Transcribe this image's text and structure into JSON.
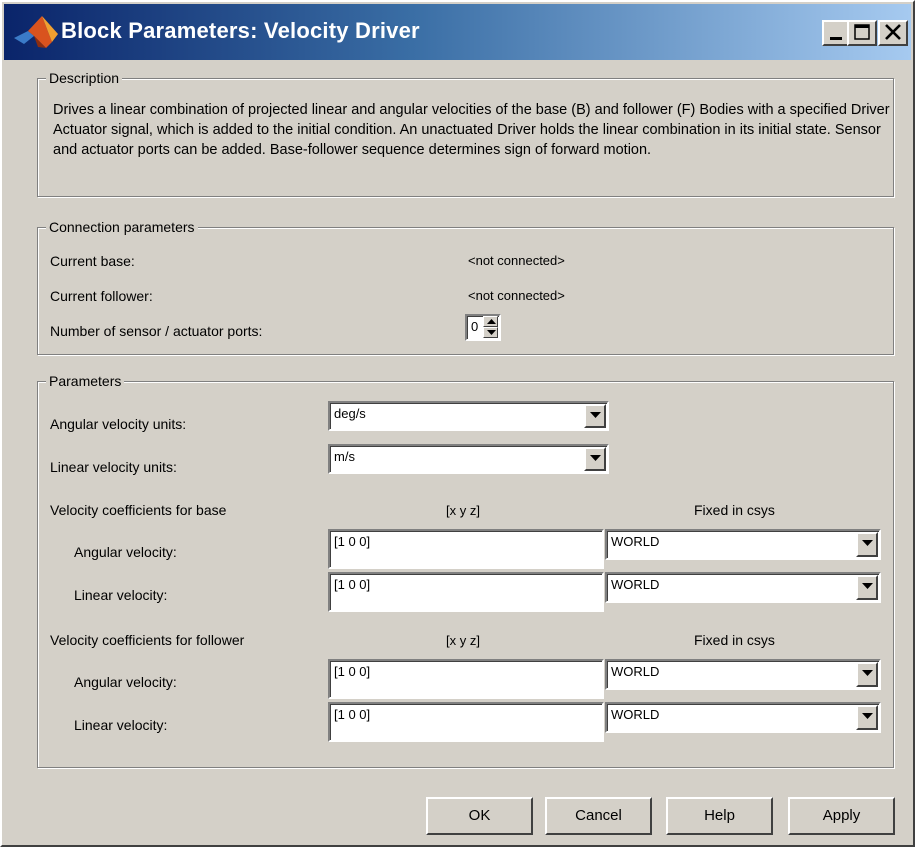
{
  "window": {
    "title": "Block Parameters: Velocity Driver",
    "title_icon": "matlab-logo-icon",
    "controls": {
      "minimize": "minimize-icon",
      "maximize": "maximize-icon",
      "close": "close-icon"
    }
  },
  "description": {
    "label": "Description",
    "text": "Drives a linear combination of projected linear and angular velocities of the base (B) and follower (F) Bodies with a specified Driver Actuator signal, which is added to the initial condition. An unactuated Driver holds the linear combination in its initial state. Sensor and actuator ports can be added. Base-follower sequence determines sign of forward motion."
  },
  "connection": {
    "label": "Connection parameters",
    "current_base_label": "Current base:",
    "current_base_value": "<not connected>",
    "current_follower_label": "Current follower:",
    "current_follower_value": "<not connected>",
    "ports_label": "Number of sensor / actuator ports:",
    "ports_value": "0"
  },
  "parameters": {
    "label": "Parameters",
    "angular_units_label": "Angular velocity units:",
    "angular_units_value": "deg/s",
    "linear_units_label": "Linear velocity units:",
    "linear_units_value": "m/s",
    "base": {
      "label": "Velocity coefficients for base",
      "xyz_header": "[x y z]",
      "csys_header": "Fixed in csys",
      "angular_label": "Angular velocity:",
      "angular_value": "[1 0 0]",
      "angular_csys": "WORLD",
      "linear_label": "Linear velocity:",
      "linear_value": "[1 0 0]",
      "linear_csys": "WORLD"
    },
    "follower": {
      "label": "Velocity coefficients for follower",
      "xyz_header": "[x y z]",
      "csys_header": "Fixed in csys",
      "angular_label": "Angular velocity:",
      "angular_value": "[1 0 0]",
      "angular_csys": "WORLD",
      "linear_label": "Linear velocity:",
      "linear_value": "[1 0 0]",
      "linear_csys": "WORLD"
    }
  },
  "buttons": {
    "ok": "OK",
    "cancel": "Cancel",
    "help": "Help",
    "apply": "Apply"
  }
}
